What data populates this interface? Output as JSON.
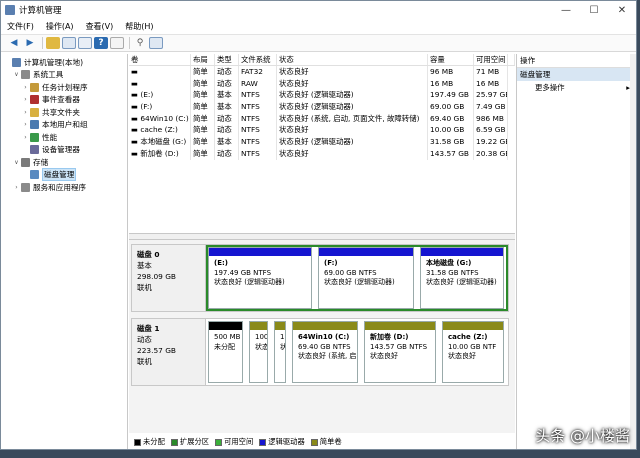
{
  "window": {
    "title": "计算机管理",
    "min": "—",
    "max": "☐",
    "close": "✕"
  },
  "menu": [
    "文件(F)",
    "操作(A)",
    "查看(V)",
    "帮助(H)"
  ],
  "tree": [
    {
      "label": "计算机管理(本地)",
      "level": 0,
      "ex": "",
      "icon": "#5a7fb0"
    },
    {
      "label": "系统工具",
      "level": 1,
      "ex": "∨",
      "icon": "#8a8a8a"
    },
    {
      "label": "任务计划程序",
      "level": 2,
      "ex": "›",
      "icon": "#c49a3a"
    },
    {
      "label": "事件查看器",
      "level": 2,
      "ex": "›",
      "icon": "#b03030"
    },
    {
      "label": "共享文件夹",
      "level": 2,
      "ex": "›",
      "icon": "#d8b040"
    },
    {
      "label": "本地用户和组",
      "level": 2,
      "ex": "›",
      "icon": "#4a7ab0"
    },
    {
      "label": "性能",
      "level": 2,
      "ex": "›",
      "icon": "#3a9a4a"
    },
    {
      "label": "设备管理器",
      "level": 2,
      "ex": "",
      "icon": "#6a6a9a"
    },
    {
      "label": "存储",
      "level": 1,
      "ex": "∨",
      "icon": "#7a7a7a"
    },
    {
      "label": "磁盘管理",
      "level": 2,
      "ex": "",
      "icon": "#5a8ac0",
      "selected": true
    },
    {
      "label": "服务和应用程序",
      "level": 1,
      "ex": "›",
      "icon": "#8a8a8a"
    }
  ],
  "volume_table": {
    "headers": [
      "卷",
      "布局",
      "类型",
      "文件系统",
      "状态",
      "容量",
      "可用空间",
      ""
    ],
    "rows": [
      [
        "▬",
        "简单",
        "动态",
        "FAT32",
        "状态良好",
        "96 MB",
        "71 MB"
      ],
      [
        "▬",
        "简单",
        "动态",
        "RAW",
        "状态良好",
        "16 MB",
        "16 MB"
      ],
      [
        "▬ (E:)",
        "简单",
        "基本",
        "NTFS",
        "状态良好 (逻辑驱动器)",
        "197.49 GB",
        "25.97 GB"
      ],
      [
        "▬ (F:)",
        "简单",
        "基本",
        "NTFS",
        "状态良好 (逻辑驱动器)",
        "69.00 GB",
        "7.49 GB"
      ],
      [
        "▬ 64Win10 (C:)",
        "简单",
        "动态",
        "NTFS",
        "状态良好 (系统, 启动, 页面文件, 故障转储)",
        "69.40 GB",
        "986 MB"
      ],
      [
        "▬ cache (Z:)",
        "简单",
        "动态",
        "NTFS",
        "状态良好",
        "10.00 GB",
        "6.59 GB"
      ],
      [
        "▬ 本地磁盘 (G:)",
        "简单",
        "基本",
        "NTFS",
        "状态良好 (逻辑驱动器)",
        "31.58 GB",
        "19.22 GB"
      ],
      [
        "▬ 新加卷 (D:)",
        "简单",
        "动态",
        "NTFS",
        "状态良好",
        "143.57 GB",
        "20.38 GB"
      ]
    ]
  },
  "disks": [
    {
      "name": "磁盘 0",
      "type": "基本",
      "size": "298.09 GB",
      "status": "联机",
      "partitions": [
        {
          "name": "(E:)",
          "size": "197.49 GB NTFS",
          "status": "状态良好 (逻辑驱动器)",
          "color": "#1515d0"
        },
        {
          "name": "(F:)",
          "size": "69.00 GB NTFS",
          "status": "状态良好 (逻辑驱动器)",
          "color": "#1515d0"
        },
        {
          "name": "本地磁盘 (G:)",
          "size": "31.58 GB NTFS",
          "status": "状态良好 (逻辑驱动器)",
          "color": "#1515d0"
        }
      ]
    },
    {
      "name": "磁盘 1",
      "type": "动态",
      "size": "223.57 GB",
      "status": "联机",
      "partitions": [
        {
          "name": "",
          "size": "500 MB",
          "status": "未分配",
          "color": "#000000"
        },
        {
          "name": "",
          "size": "100 M",
          "status": "状态良",
          "color": "#8a8a1a"
        },
        {
          "name": "",
          "size": "16",
          "status": "状态",
          "color": "#8a8a1a"
        },
        {
          "name": "64Win10 (C:)",
          "size": "69.40 GB NTFS",
          "status": "状态良好 (系统, 启",
          "color": "#8a8a1a"
        },
        {
          "name": "新加卷 (D:)",
          "size": "143.57 GB NTFS",
          "status": "状态良好",
          "color": "#8a8a1a"
        },
        {
          "name": "cache (Z:)",
          "size": "10.00 GB NTF",
          "status": "状态良好",
          "color": "#8a8a1a"
        }
      ]
    }
  ],
  "legend": [
    {
      "label": "未分配",
      "color": "#000000"
    },
    {
      "label": "扩展分区",
      "color": "#2a8a2a"
    },
    {
      "label": "可用空间",
      "color": "#3ab03a"
    },
    {
      "label": "逻辑驱动器",
      "color": "#1515d0"
    },
    {
      "label": "简单卷",
      "color": "#8a8a1a"
    }
  ],
  "actions": {
    "header": "操作",
    "section": "磁盘管理",
    "more": "更多操作",
    "arrow": "▸"
  },
  "watermark": "头条 @小楼酱"
}
